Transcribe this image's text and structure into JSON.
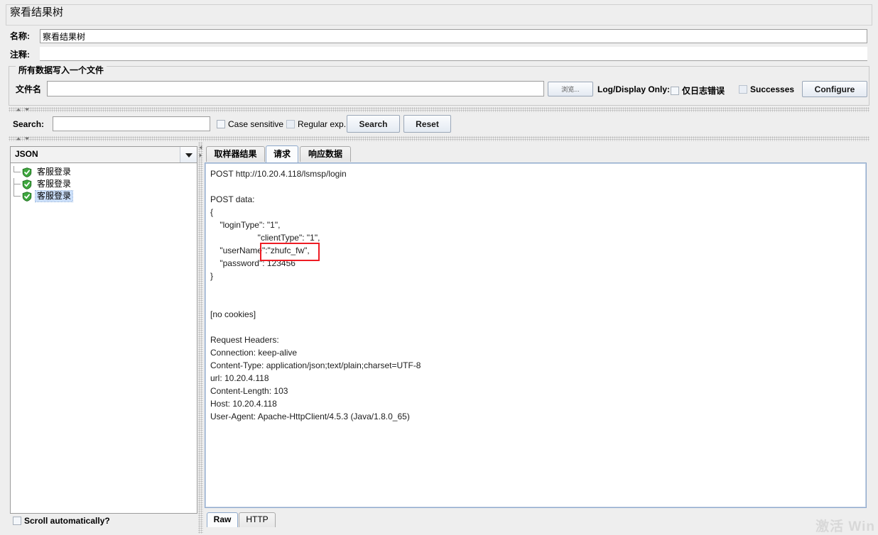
{
  "window": {
    "title": "察看结果树"
  },
  "form": {
    "name_label": "名称:",
    "name_value": "察看结果树",
    "comment_label": "注释:",
    "comment_value": ""
  },
  "file_group": {
    "legend": "所有数据写入一个文件",
    "filename_label": "文件名",
    "filename_value": "",
    "browse_button": "浏览...",
    "log_display_label": "Log/Display Only:",
    "errors_only_label": "仅日志错误",
    "errors_only_checked": false,
    "successes_label": "Successes",
    "successes_checked": false,
    "configure_button": "Configure"
  },
  "search_bar": {
    "label": "Search:",
    "value": "",
    "case_sensitive_label": "Case sensitive",
    "case_sensitive_checked": false,
    "regular_exp_label": "Regular exp.",
    "regular_exp_checked": false,
    "search_button": "Search",
    "reset_button": "Reset"
  },
  "left_panel": {
    "renderer_selected": "JSON",
    "tree_items": [
      {
        "label": "客服登录",
        "status": "success",
        "selected": false
      },
      {
        "label": "客服登录",
        "status": "success",
        "selected": false
      },
      {
        "label": "客服登录",
        "status": "success",
        "selected": true
      }
    ],
    "scroll_auto_label": "Scroll automatically?",
    "scroll_auto_checked": false
  },
  "right_panel": {
    "tabs": [
      {
        "label": "取样器结果",
        "active": false
      },
      {
        "label": "请求",
        "active": true
      },
      {
        "label": "响应数据",
        "active": false
      }
    ],
    "bottom_tabs": [
      {
        "label": "Raw",
        "active": true
      },
      {
        "label": "HTTP",
        "active": false
      }
    ],
    "content_lines": [
      "POST http://10.20.4.118/lsmsp/login",
      "",
      "POST data:",
      "{",
      "    \"loginType\": \"1\",",
      "                    \"clientType\": \"1\",",
      "    \"userName\":\"zhufc_fw\",",
      "    \"password\": 123456",
      "}",
      "",
      "",
      "[no cookies]",
      "",
      "Request Headers:",
      "Connection: keep-alive",
      "Content-Type: application/json;text/plain;charset=UTF-8",
      "url: 10.20.4.118",
      "Content-Length: 103",
      "Host: 10.20.4.118",
      "User-Agent: Apache-HttpClient/4.5.3 (Java/1.8.0_65)"
    ]
  },
  "annotation": {
    "highlight_text": ":\"zhufc_fw\",",
    "highlight_color": "#ee1c24"
  },
  "watermark": {
    "text": "激活 Win"
  }
}
